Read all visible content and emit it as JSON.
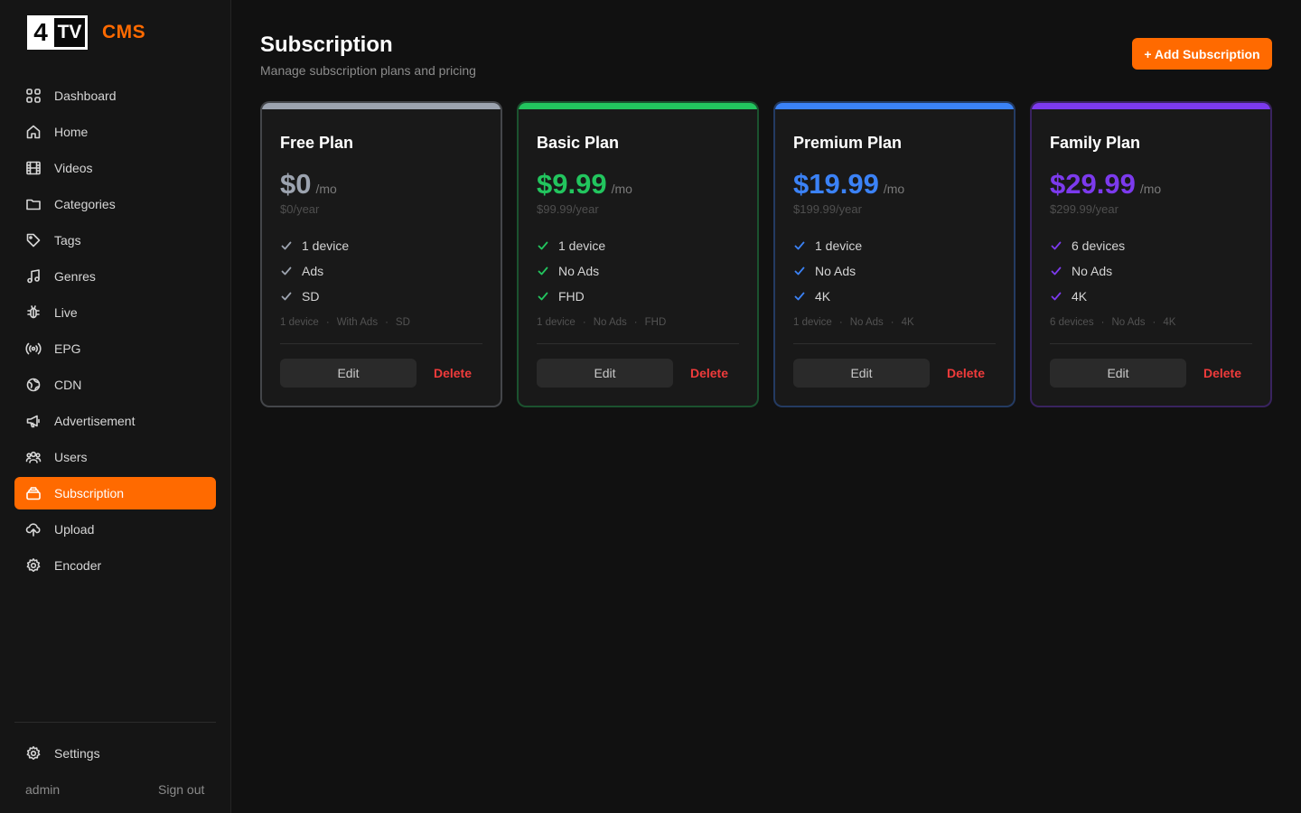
{
  "app": {
    "logo_number": "4",
    "logo_tv": "TV",
    "logo_suffix": "CMS"
  },
  "sidebar": {
    "items": [
      {
        "label": "Dashboard",
        "icon": "grid-icon"
      },
      {
        "label": "Home",
        "icon": "home-icon"
      },
      {
        "label": "Videos",
        "icon": "film-icon"
      },
      {
        "label": "Categories",
        "icon": "folder-icon"
      },
      {
        "label": "Tags",
        "icon": "tag-icon"
      },
      {
        "label": "Genres",
        "icon": "music-icon"
      },
      {
        "label": "Live",
        "icon": "bug-icon"
      },
      {
        "label": "EPG",
        "icon": "broadcast-icon"
      },
      {
        "label": "CDN",
        "icon": "globe-icon"
      },
      {
        "label": "Advertisement",
        "icon": "megaphone-icon"
      },
      {
        "label": "Users",
        "icon": "users-icon"
      },
      {
        "label": "Subscription",
        "icon": "subscription-icon",
        "active": true
      },
      {
        "label": "Upload",
        "icon": "cloud-upload-icon"
      },
      {
        "label": "Encoder",
        "icon": "gear-icon"
      }
    ],
    "settings_label": "Settings",
    "user": "admin",
    "signout_label": "Sign out"
  },
  "header": {
    "title": "Subscription",
    "subtitle": "Manage subscription plans and pricing",
    "add_label": "+ Add Subscription"
  },
  "accent_color": "#ff6a00",
  "plans": [
    {
      "name": "Free Plan",
      "price": "$0",
      "unit": "/mo",
      "yearly": "$0/year",
      "color": "#9ca3af",
      "features": [
        "1 device",
        "Ads",
        "SD"
      ],
      "summary": [
        "1 device",
        "With Ads",
        "SD"
      ],
      "edit_label": "Edit",
      "delete_label": "Delete"
    },
    {
      "name": "Basic Plan",
      "price": "$9.99",
      "unit": "/mo",
      "yearly": "$99.99/year",
      "color": "#22c55e",
      "features": [
        "1 device",
        "No Ads",
        "FHD"
      ],
      "summary": [
        "1 device",
        "No Ads",
        "FHD"
      ],
      "edit_label": "Edit",
      "delete_label": "Delete"
    },
    {
      "name": "Premium Plan",
      "price": "$19.99",
      "unit": "/mo",
      "yearly": "$199.99/year",
      "color": "#3b82f6",
      "features": [
        "1 device",
        "No Ads",
        "4K"
      ],
      "summary": [
        "1 device",
        "No Ads",
        "4K"
      ],
      "edit_label": "Edit",
      "delete_label": "Delete"
    },
    {
      "name": "Family Plan",
      "price": "$29.99",
      "unit": "/mo",
      "yearly": "$299.99/year",
      "color": "#7c3aed",
      "features": [
        "6 devices",
        "No Ads",
        "4K"
      ],
      "summary": [
        "6 devices",
        "No Ads",
        "4K"
      ],
      "edit_label": "Edit",
      "delete_label": "Delete"
    }
  ]
}
